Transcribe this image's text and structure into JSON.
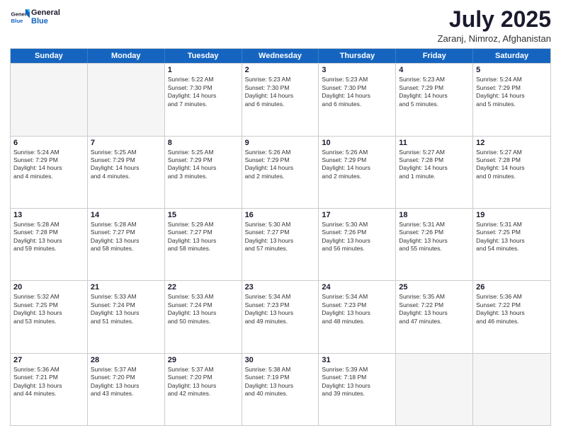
{
  "header": {
    "logo_general": "General",
    "logo_blue": "Blue",
    "month": "July 2025",
    "location": "Zaranj, Nimroz, Afghanistan"
  },
  "days_of_week": [
    "Sunday",
    "Monday",
    "Tuesday",
    "Wednesday",
    "Thursday",
    "Friday",
    "Saturday"
  ],
  "weeks": [
    [
      {
        "day": "",
        "empty": true
      },
      {
        "day": "",
        "empty": true
      },
      {
        "day": "1",
        "lines": [
          "Sunrise: 5:22 AM",
          "Sunset: 7:30 PM",
          "Daylight: 14 hours",
          "and 7 minutes."
        ]
      },
      {
        "day": "2",
        "lines": [
          "Sunrise: 5:23 AM",
          "Sunset: 7:30 PM",
          "Daylight: 14 hours",
          "and 6 minutes."
        ]
      },
      {
        "day": "3",
        "lines": [
          "Sunrise: 5:23 AM",
          "Sunset: 7:30 PM",
          "Daylight: 14 hours",
          "and 6 minutes."
        ]
      },
      {
        "day": "4",
        "lines": [
          "Sunrise: 5:23 AM",
          "Sunset: 7:29 PM",
          "Daylight: 14 hours",
          "and 5 minutes."
        ]
      },
      {
        "day": "5",
        "lines": [
          "Sunrise: 5:24 AM",
          "Sunset: 7:29 PM",
          "Daylight: 14 hours",
          "and 5 minutes."
        ]
      }
    ],
    [
      {
        "day": "6",
        "lines": [
          "Sunrise: 5:24 AM",
          "Sunset: 7:29 PM",
          "Daylight: 14 hours",
          "and 4 minutes."
        ]
      },
      {
        "day": "7",
        "lines": [
          "Sunrise: 5:25 AM",
          "Sunset: 7:29 PM",
          "Daylight: 14 hours",
          "and 4 minutes."
        ]
      },
      {
        "day": "8",
        "lines": [
          "Sunrise: 5:25 AM",
          "Sunset: 7:29 PM",
          "Daylight: 14 hours",
          "and 3 minutes."
        ]
      },
      {
        "day": "9",
        "lines": [
          "Sunrise: 5:26 AM",
          "Sunset: 7:29 PM",
          "Daylight: 14 hours",
          "and 2 minutes."
        ]
      },
      {
        "day": "10",
        "lines": [
          "Sunrise: 5:26 AM",
          "Sunset: 7:29 PM",
          "Daylight: 14 hours",
          "and 2 minutes."
        ]
      },
      {
        "day": "11",
        "lines": [
          "Sunrise: 5:27 AM",
          "Sunset: 7:28 PM",
          "Daylight: 14 hours",
          "and 1 minute."
        ]
      },
      {
        "day": "12",
        "lines": [
          "Sunrise: 5:27 AM",
          "Sunset: 7:28 PM",
          "Daylight: 14 hours",
          "and 0 minutes."
        ]
      }
    ],
    [
      {
        "day": "13",
        "lines": [
          "Sunrise: 5:28 AM",
          "Sunset: 7:28 PM",
          "Daylight: 13 hours",
          "and 59 minutes."
        ]
      },
      {
        "day": "14",
        "lines": [
          "Sunrise: 5:28 AM",
          "Sunset: 7:27 PM",
          "Daylight: 13 hours",
          "and 58 minutes."
        ]
      },
      {
        "day": "15",
        "lines": [
          "Sunrise: 5:29 AM",
          "Sunset: 7:27 PM",
          "Daylight: 13 hours",
          "and 58 minutes."
        ]
      },
      {
        "day": "16",
        "lines": [
          "Sunrise: 5:30 AM",
          "Sunset: 7:27 PM",
          "Daylight: 13 hours",
          "and 57 minutes."
        ]
      },
      {
        "day": "17",
        "lines": [
          "Sunrise: 5:30 AM",
          "Sunset: 7:26 PM",
          "Daylight: 13 hours",
          "and 56 minutes."
        ]
      },
      {
        "day": "18",
        "lines": [
          "Sunrise: 5:31 AM",
          "Sunset: 7:26 PM",
          "Daylight: 13 hours",
          "and 55 minutes."
        ]
      },
      {
        "day": "19",
        "lines": [
          "Sunrise: 5:31 AM",
          "Sunset: 7:25 PM",
          "Daylight: 13 hours",
          "and 54 minutes."
        ]
      }
    ],
    [
      {
        "day": "20",
        "lines": [
          "Sunrise: 5:32 AM",
          "Sunset: 7:25 PM",
          "Daylight: 13 hours",
          "and 53 minutes."
        ]
      },
      {
        "day": "21",
        "lines": [
          "Sunrise: 5:33 AM",
          "Sunset: 7:24 PM",
          "Daylight: 13 hours",
          "and 51 minutes."
        ]
      },
      {
        "day": "22",
        "lines": [
          "Sunrise: 5:33 AM",
          "Sunset: 7:24 PM",
          "Daylight: 13 hours",
          "and 50 minutes."
        ]
      },
      {
        "day": "23",
        "lines": [
          "Sunrise: 5:34 AM",
          "Sunset: 7:23 PM",
          "Daylight: 13 hours",
          "and 49 minutes."
        ]
      },
      {
        "day": "24",
        "lines": [
          "Sunrise: 5:34 AM",
          "Sunset: 7:23 PM",
          "Daylight: 13 hours",
          "and 48 minutes."
        ]
      },
      {
        "day": "25",
        "lines": [
          "Sunrise: 5:35 AM",
          "Sunset: 7:22 PM",
          "Daylight: 13 hours",
          "and 47 minutes."
        ]
      },
      {
        "day": "26",
        "lines": [
          "Sunrise: 5:36 AM",
          "Sunset: 7:22 PM",
          "Daylight: 13 hours",
          "and 46 minutes."
        ]
      }
    ],
    [
      {
        "day": "27",
        "lines": [
          "Sunrise: 5:36 AM",
          "Sunset: 7:21 PM",
          "Daylight: 13 hours",
          "and 44 minutes."
        ]
      },
      {
        "day": "28",
        "lines": [
          "Sunrise: 5:37 AM",
          "Sunset: 7:20 PM",
          "Daylight: 13 hours",
          "and 43 minutes."
        ]
      },
      {
        "day": "29",
        "lines": [
          "Sunrise: 5:37 AM",
          "Sunset: 7:20 PM",
          "Daylight: 13 hours",
          "and 42 minutes."
        ]
      },
      {
        "day": "30",
        "lines": [
          "Sunrise: 5:38 AM",
          "Sunset: 7:19 PM",
          "Daylight: 13 hours",
          "and 40 minutes."
        ]
      },
      {
        "day": "31",
        "lines": [
          "Sunrise: 5:39 AM",
          "Sunset: 7:18 PM",
          "Daylight: 13 hours",
          "and 39 minutes."
        ]
      },
      {
        "day": "",
        "empty": true
      },
      {
        "day": "",
        "empty": true
      }
    ]
  ]
}
